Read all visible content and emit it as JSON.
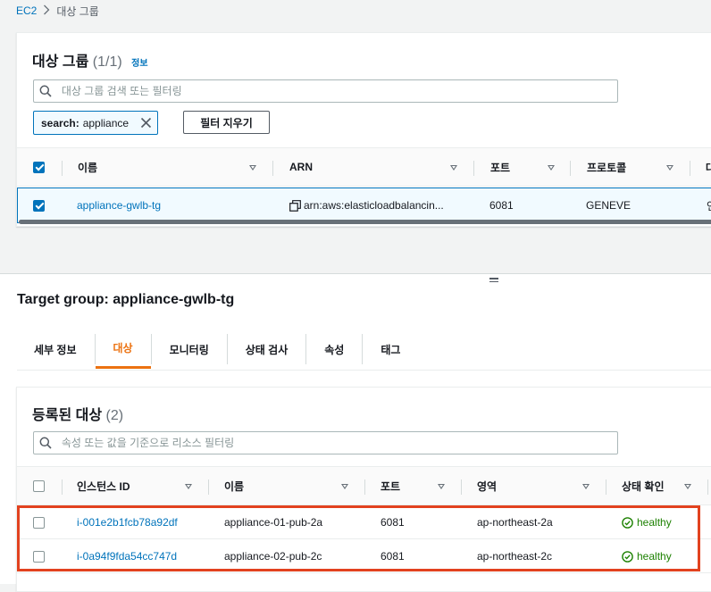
{
  "breadcrumb": {
    "root": "EC2",
    "current": "대상 그룹"
  },
  "target_groups_panel": {
    "title": "대상 그룹",
    "count": "(1/1)",
    "info_link": "정보",
    "search_placeholder": "대상 그룹 검색 또는 필터링",
    "filter_token": {
      "key": "search:",
      "value": "appliance"
    },
    "clear_filters_label": "필터 지우기",
    "columns": [
      "이름",
      "ARN",
      "포트",
      "프로토콜",
      "대"
    ],
    "rows": [
      {
        "selected": true,
        "name": "appliance-gwlb-tg",
        "arn": "arn:aws:elasticloadbalancin...",
        "port": "6081",
        "protocol": "GENEVE",
        "extra": "인"
      }
    ]
  },
  "detail": {
    "title": "Target group: appliance-gwlb-tg",
    "tabs": [
      {
        "label": "세부 정보",
        "active": false
      },
      {
        "label": "대상",
        "active": true
      },
      {
        "label": "모니터링",
        "active": false
      },
      {
        "label": "상태 검사",
        "active": false
      },
      {
        "label": "속성",
        "active": false
      },
      {
        "label": "태그",
        "active": false
      }
    ]
  },
  "registered_targets": {
    "title": "등록된 대상",
    "count": "(2)",
    "search_placeholder": "속성 또는 값을 기준으로 리소스 필터링",
    "columns": [
      "인스턴스 ID",
      "이름",
      "포트",
      "영역",
      "상태 확인"
    ],
    "rows": [
      {
        "instance_id": "i-001e2b1fcb78a92df",
        "name": "appliance-01-pub-2a",
        "port": "6081",
        "zone": "ap-northeast-2a",
        "health": "healthy"
      },
      {
        "instance_id": "i-0a94f9fda54cc747d",
        "name": "appliance-02-pub-2c",
        "port": "6081",
        "zone": "ap-northeast-2c",
        "health": "healthy"
      }
    ]
  },
  "colors": {
    "link": "#0073bb",
    "accent": "#ec7211",
    "healthy": "#1d8102",
    "highlight": "#e2421f"
  }
}
